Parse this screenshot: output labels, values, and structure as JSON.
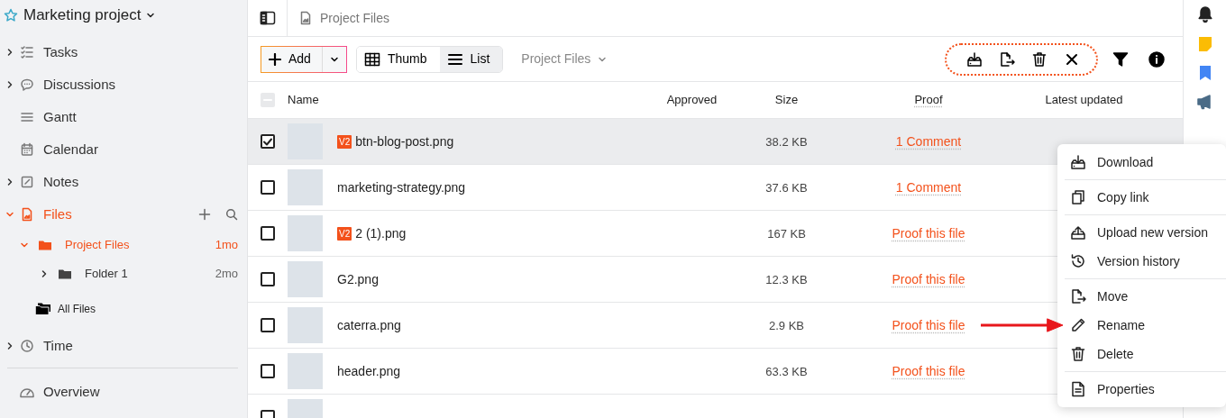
{
  "project": {
    "title": "Marketing project",
    "starred": false
  },
  "sidebar": {
    "items": [
      {
        "label": "Tasks",
        "expanded": false,
        "selected": false
      },
      {
        "label": "Discussions",
        "expanded": false,
        "selected": false
      },
      {
        "label": "Gantt",
        "selected": false
      },
      {
        "label": "Calendar",
        "selected": false
      },
      {
        "label": "Notes",
        "expanded": false,
        "selected": false
      },
      {
        "label": "Files",
        "expanded": true,
        "selected": true,
        "children": [
          {
            "label": "Project Files",
            "time": "1mo",
            "expanded": true,
            "selected": true,
            "children": [
              {
                "label": "Folder 1",
                "time": "2mo",
                "expanded": false,
                "selected": false
              }
            ]
          }
        ],
        "all_files": "All Files"
      },
      {
        "label": "Time",
        "expanded": false,
        "selected": false
      }
    ],
    "footer_items": [
      {
        "label": "Overview"
      }
    ]
  },
  "breadcrumb": "Project Files",
  "toolbar": {
    "add_label": "Add",
    "views": [
      {
        "label": "Thumb",
        "selected": false
      },
      {
        "label": "List",
        "selected": true
      }
    ],
    "folder_select": "Project Files"
  },
  "table": {
    "select_all_partial": true,
    "columns": [
      "Name",
      "Approved",
      "Size",
      "Proof",
      "Latest updated"
    ],
    "rows": [
      {
        "selected": true,
        "version": "V2",
        "name": "btn-blog-post.png",
        "size": "38.2 KB",
        "proof": "1 Comment"
      },
      {
        "selected": false,
        "name": "marketing-strategy.png",
        "size": "37.6 KB",
        "proof": "1 Comment"
      },
      {
        "selected": false,
        "version": "V2",
        "name": "2 (1).png",
        "size": "167 KB",
        "proof": "Proof this file"
      },
      {
        "selected": false,
        "name": "G2.png",
        "size": "12.3 KB",
        "proof": "Proof this file"
      },
      {
        "selected": false,
        "name": "caterra.png",
        "size": "2.9 KB",
        "proof": "Proof this file"
      },
      {
        "selected": false,
        "name": "header.png",
        "size": "63.3 KB",
        "proof": "Proof this file"
      },
      {
        "selected": false
      }
    ]
  },
  "context_menu": {
    "groups": [
      {
        "items": [
          {
            "label": "Download",
            "pointed_at": false
          }
        ]
      },
      {
        "items": [
          {
            "label": "Copy link",
            "pointed_at": false
          }
        ]
      },
      {
        "items": [
          {
            "label": "Upload new version",
            "pointed_at": false
          },
          {
            "label": "Version history",
            "pointed_at": false
          }
        ]
      },
      {
        "items": [
          {
            "label": "Move",
            "pointed_at": false
          },
          {
            "label": "Rename",
            "pointed_at": true
          },
          {
            "label": "Delete",
            "pointed_at": false
          }
        ]
      },
      {
        "items": [
          {
            "label": "Properties",
            "pointed_at": false
          }
        ]
      }
    ]
  }
}
